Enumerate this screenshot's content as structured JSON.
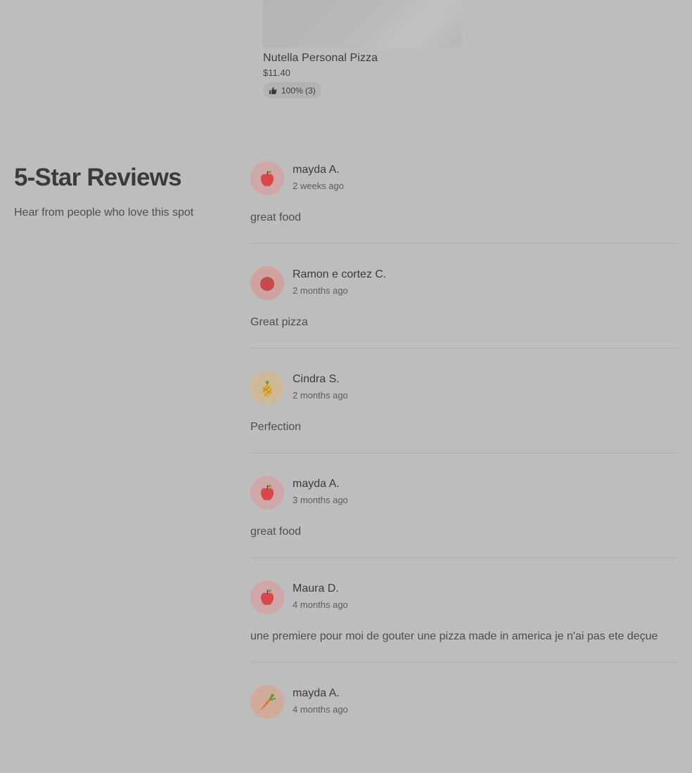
{
  "item": {
    "name": "Nutella Personal Pizza",
    "price": "$11.40",
    "rating": "100% (3)",
    "rating_icon": "thumbs-up-icon"
  },
  "reviews_section": {
    "title": "5-Star Reviews",
    "subtitle": "Hear from people who love this spot"
  },
  "reviews": [
    {
      "name": "mayda A.",
      "time": "2 weeks ago",
      "text": "great food",
      "avatar_icon": "apple-icon",
      "avatar_bg": "#cfa7a7"
    },
    {
      "name": "Ramon e cortez C.",
      "time": "2 months ago",
      "text": "Great pizza",
      "avatar_icon": "tomato-icon",
      "avatar_bg": "#d0a2a0"
    },
    {
      "name": "Cindra S.",
      "time": "2 months ago",
      "text": "Perfection",
      "avatar_icon": "pineapple-icon",
      "avatar_bg": "#cdb997"
    },
    {
      "name": "mayda A.",
      "time": "3 months ago",
      "text": "great food",
      "avatar_icon": "apple-icon",
      "avatar_bg": "#cfa7a7"
    },
    {
      "name": "Maura D.",
      "time": "4 months ago",
      "text": "une premiere pour moi de gouter une pizza made in america je n'ai pas ete deçue",
      "avatar_icon": "apple-icon",
      "avatar_bg": "#cfa7a7"
    },
    {
      "name": "mayda A.",
      "time": "4 months ago",
      "text": "",
      "avatar_icon": "carrot-icon",
      "avatar_bg": "#d0ab99"
    }
  ]
}
